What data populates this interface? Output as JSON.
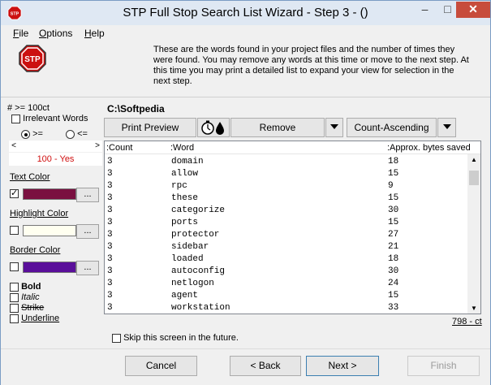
{
  "window": {
    "title": "STP Full Stop Search List Wizard - Step 3 - ()"
  },
  "titlebar": {
    "min": "–",
    "max": "□",
    "close": "✕"
  },
  "menu": {
    "items": [
      {
        "label_u": "F",
        "label_rest": "ile"
      },
      {
        "label_u": "O",
        "label_rest": "ptions"
      },
      {
        "label_u": "H",
        "label_rest": "elp"
      }
    ]
  },
  "intro": "These are the words found in your project files and the number of times they were found. You may remove any words at this time or move to the next step. At this time you may print a detailed list to expand your view for selection in the next step.",
  "left": {
    "threshold": "# >= 100ct",
    "irrelevant_label": "Irrelevant Words",
    "radio_ge": ">=",
    "radio_le": "<=",
    "scroll_left": "<",
    "scroll_right": ">",
    "value_text": "100 - Yes",
    "text_color_label": "Text Color",
    "highlight_color_label": "Highlight Color",
    "border_color_label": "Border Color",
    "dots": "...",
    "text_color": "#7a1040",
    "highlight_color": "#fffff0",
    "border_color": "#5a0f9a",
    "bold": "Bold",
    "italic": "Italic",
    "strike": "Strike",
    "underline": "Underline"
  },
  "path": "C:\\Softpedia",
  "toolbar": {
    "print_preview": "Print Preview",
    "remove": "Remove",
    "sort": "Count-Ascending"
  },
  "list": {
    "headers": {
      "count": ":Count",
      "word": ":Word",
      "bytes": ":Approx. bytes saved"
    },
    "rows": [
      {
        "count": "3",
        "word": "domain",
        "bytes": "18"
      },
      {
        "count": "3",
        "word": "allow",
        "bytes": "15"
      },
      {
        "count": "3",
        "word": "rpc",
        "bytes": "9"
      },
      {
        "count": "3",
        "word": "these",
        "bytes": "15"
      },
      {
        "count": "3",
        "word": "categorize",
        "bytes": "30"
      },
      {
        "count": "3",
        "word": "ports",
        "bytes": "15"
      },
      {
        "count": "3",
        "word": "protector",
        "bytes": "27"
      },
      {
        "count": "3",
        "word": "sidebar",
        "bytes": "21"
      },
      {
        "count": "3",
        "word": "loaded",
        "bytes": "18"
      },
      {
        "count": "3",
        "word": "autoconfig",
        "bytes": "30"
      },
      {
        "count": "3",
        "word": "netlogon",
        "bytes": "24"
      },
      {
        "count": "3",
        "word": "agent",
        "bytes": "15"
      },
      {
        "count": "3",
        "word": "workstation",
        "bytes": "33"
      }
    ],
    "total": "798 - ct"
  },
  "skip_label": "Skip this screen in the future.",
  "buttons": {
    "cancel": "Cancel",
    "back": "< Back",
    "next": "Next >",
    "finish": "Finish"
  }
}
